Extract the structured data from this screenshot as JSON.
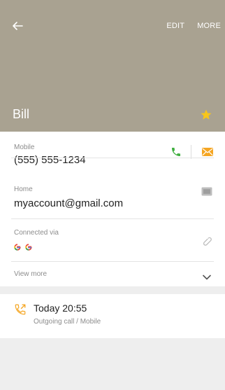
{
  "header": {
    "actions": [
      "EDIT",
      "MORE"
    ],
    "contact_name": "Bill",
    "favorite": true
  },
  "details": {
    "mobile": {
      "label": "Mobile",
      "value": "(555) 555-1234"
    },
    "home": {
      "label": "Home",
      "value": "myaccount@gmail.com"
    },
    "connected": {
      "label": "Connected via",
      "accounts": [
        "google",
        "google"
      ]
    },
    "view_more": "View more"
  },
  "log": {
    "time": "Today 20:55",
    "detail": "Outgoing call / Mobile"
  },
  "colors": {
    "header_bg": "#a9a291",
    "call_green": "#3fae3f",
    "message_orange": "#f5a623",
    "star_yellow": "#f8c61a"
  }
}
